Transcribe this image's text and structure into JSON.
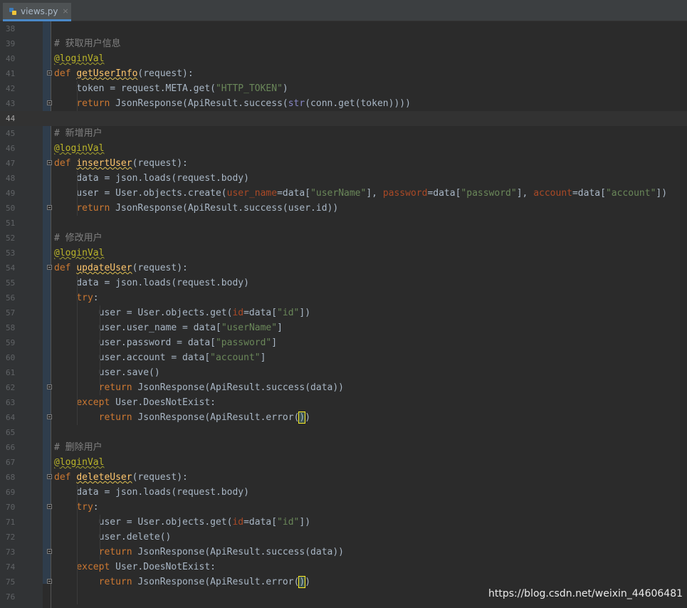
{
  "tab": {
    "filename": "views.py",
    "close": "×"
  },
  "first_line": 38,
  "current_line": 44,
  "lines": [
    "",
    "# 获取用户信息",
    "@loginVal",
    "def getUserInfo(request):",
    "    token = request.META.get(\"HTTP_TOKEN\")",
    "    return JsonResponse(ApiResult.success(str(conn.get(token))))",
    "",
    "# 新增用户",
    "@loginVal",
    "def insertUser(request):",
    "    data = json.loads(request.body)",
    "    user = User.objects.create(user_name=data[\"userName\"], password=data[\"password\"], account=data[\"account\"])",
    "    return JsonResponse(ApiResult.success(user.id))",
    "",
    "# 修改用户",
    "@loginVal",
    "def updateUser(request):",
    "    data = json.loads(request.body)",
    "    try:",
    "        user = User.objects.get(id=data[\"id\"])",
    "        user.user_name = data[\"userName\"]",
    "        user.password = data[\"password\"]",
    "        user.account = data[\"account\"]",
    "        user.save()",
    "        return JsonResponse(ApiResult.success(data))",
    "    except User.DoesNotExist:",
    "        return JsonResponse(ApiResult.error())",
    "",
    "# 删除用户",
    "@loginVal",
    "def deleteUser(request):",
    "    data = json.loads(request.body)",
    "    try:",
    "        user = User.objects.get(id=data[\"id\"])",
    "        user.delete()",
    "        return JsonResponse(ApiResult.success(data))",
    "    except User.DoesNotExist:",
    "        return JsonResponse(ApiResult.error())",
    ""
  ],
  "fold_markers": [
    41,
    43,
    47,
    50,
    54,
    62,
    64,
    68,
    70,
    73,
    75
  ],
  "watermark": "https://blog.csdn.net/weixin_44606481",
  "colors": {
    "background": "#2b2b2b",
    "keyword": "#cc7832",
    "comment": "#808080",
    "string": "#6a8759",
    "decorator": "#bbb529",
    "function": "#ffc66d",
    "builtin": "#8888c6",
    "param": "#aa4926",
    "text": "#a9b7c6"
  }
}
